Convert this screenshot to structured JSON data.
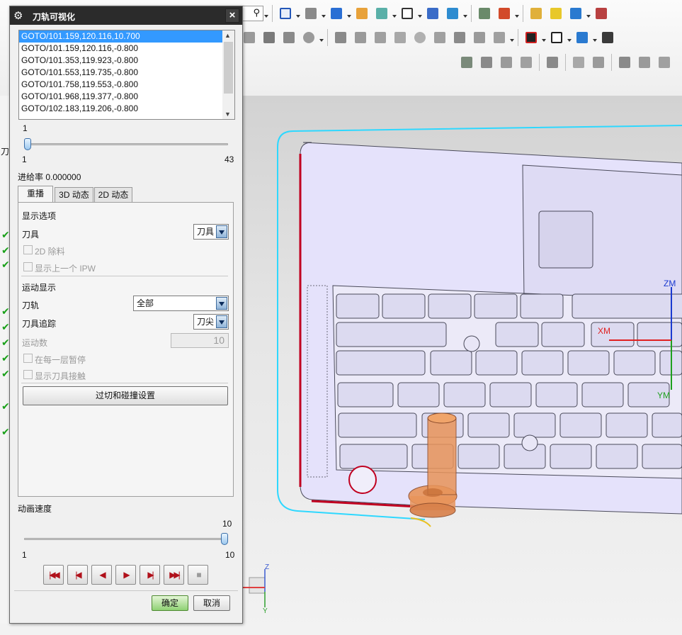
{
  "dialog": {
    "title": "刀轨可视化",
    "close_label": "×",
    "gear_label": "⚙",
    "goto_list": [
      "GOTO/101.159,120.116,10.700",
      "GOTO/101.159,120.116,-0.800",
      "GOTO/101.353,119.923,-0.800",
      "GOTO/101.553,119.735,-0.800",
      "GOTO/101.758,119.553,-0.800",
      "GOTO/101.968,119.377,-0.800",
      "GOTO/102.183,119.206,-0.800"
    ],
    "position_slider": {
      "value": "1",
      "min": "1",
      "max": "43",
      "fraction": 0.0
    },
    "feed_rate": "进给率 0.000000",
    "tabs": [
      "重播",
      "3D 动态",
      "2D 动态"
    ],
    "display_options": {
      "heading": "显示选项",
      "tool_label": "刀具",
      "tool_value": "刀具",
      "cb_2d_material": "2D 除料",
      "cb_prev_ipw": "显示上一个 IPW"
    },
    "motion_display": {
      "heading": "运动显示",
      "path_label": "刀轨",
      "path_value": "全部",
      "trace_label": "刀具追踪",
      "trace_value": "刀尖",
      "motion_count_label": "运动数",
      "motion_count_value": "10",
      "cb_pause_layer": "在每一层暂停",
      "cb_show_contact": "显示刀具接触",
      "gouge_button": "过切和碰撞设置"
    },
    "anim_speed": {
      "label": "动画速度",
      "value": "10",
      "min": "1",
      "max": "10",
      "fraction": 1.0
    },
    "playback": [
      "|◀◀",
      "|◀",
      "◀",
      "▶",
      "▶|",
      "▶▶|",
      "■"
    ],
    "ok_label": "确定",
    "cancel_label": "取消"
  },
  "left_strip": {
    "tab_label": "刀"
  },
  "viewport": {
    "axis_zm": "ZM",
    "axis_xm": "XM",
    "axis_ym": "YM",
    "triad_z": "Z",
    "triad_y": "Y"
  },
  "colors": {
    "title_bg": "#2b2b2b",
    "selection": "#3399ff",
    "part_fill": "#e5e2fb",
    "path_cyan": "#2ed8ff",
    "tool_orange": "#e8945a",
    "accent_red": "#c00020"
  }
}
